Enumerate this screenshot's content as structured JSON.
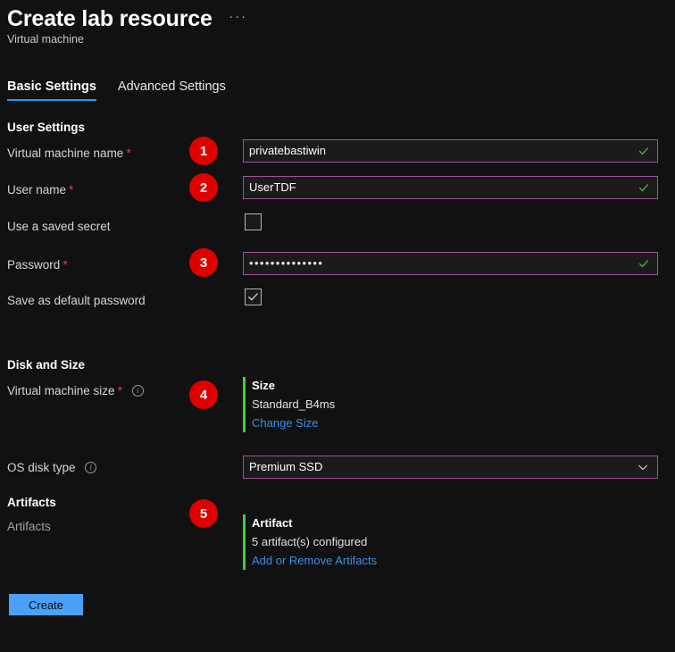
{
  "header": {
    "title": "Create lab resource",
    "subtitle": "Virtual machine",
    "more_label": "···"
  },
  "tabs": [
    {
      "label": "Basic Settings",
      "active": true
    },
    {
      "label": "Advanced Settings",
      "active": false
    }
  ],
  "sections": {
    "user_settings": {
      "heading": "User Settings",
      "vm_name": {
        "label": "Virtual machine name",
        "required_marker": "*",
        "badge": "1",
        "value": "privatebastiwin",
        "placeholder": "",
        "valid": true
      },
      "user_name": {
        "label": "User name",
        "required_marker": "*",
        "badge": "2",
        "value": "UserTDF",
        "placeholder": "",
        "valid": true
      },
      "saved_secret": {
        "label": "Use a saved secret",
        "checked": false
      },
      "password": {
        "label": "Password",
        "required_marker": "*",
        "badge": "3",
        "value": "••••••••••••••",
        "valid": true
      },
      "save_default_password": {
        "label": "Save as default password",
        "checked": true
      }
    },
    "disk_and_size": {
      "heading": "Disk and Size",
      "vm_size": {
        "label": "Virtual machine size",
        "required_marker": "*",
        "badge": "4",
        "card_title": "Size",
        "card_value": "Standard_B4ms",
        "card_link": "Change Size"
      },
      "os_disk_type": {
        "label": "OS disk type",
        "value": "Premium SSD"
      }
    },
    "artifacts": {
      "heading": "Artifacts",
      "sub_label": "Artifacts",
      "badge": "5",
      "card_title": "Artifact",
      "card_value": "5 artifact(s) configured",
      "card_link": "Add or Remove Artifacts"
    }
  },
  "footer": {
    "create_label": "Create"
  },
  "colors": {
    "background": "#111111",
    "badge_red": "#e00000",
    "input_border_purple": "#a24fa0",
    "accent_green": "#3fcf3f",
    "link_blue": "#3b8eea",
    "tab_underline_blue": "#2899f5",
    "primary_button_blue": "#4aa1f7",
    "valid_check_green": "#4caf30",
    "required_star_red": "#e04141"
  }
}
